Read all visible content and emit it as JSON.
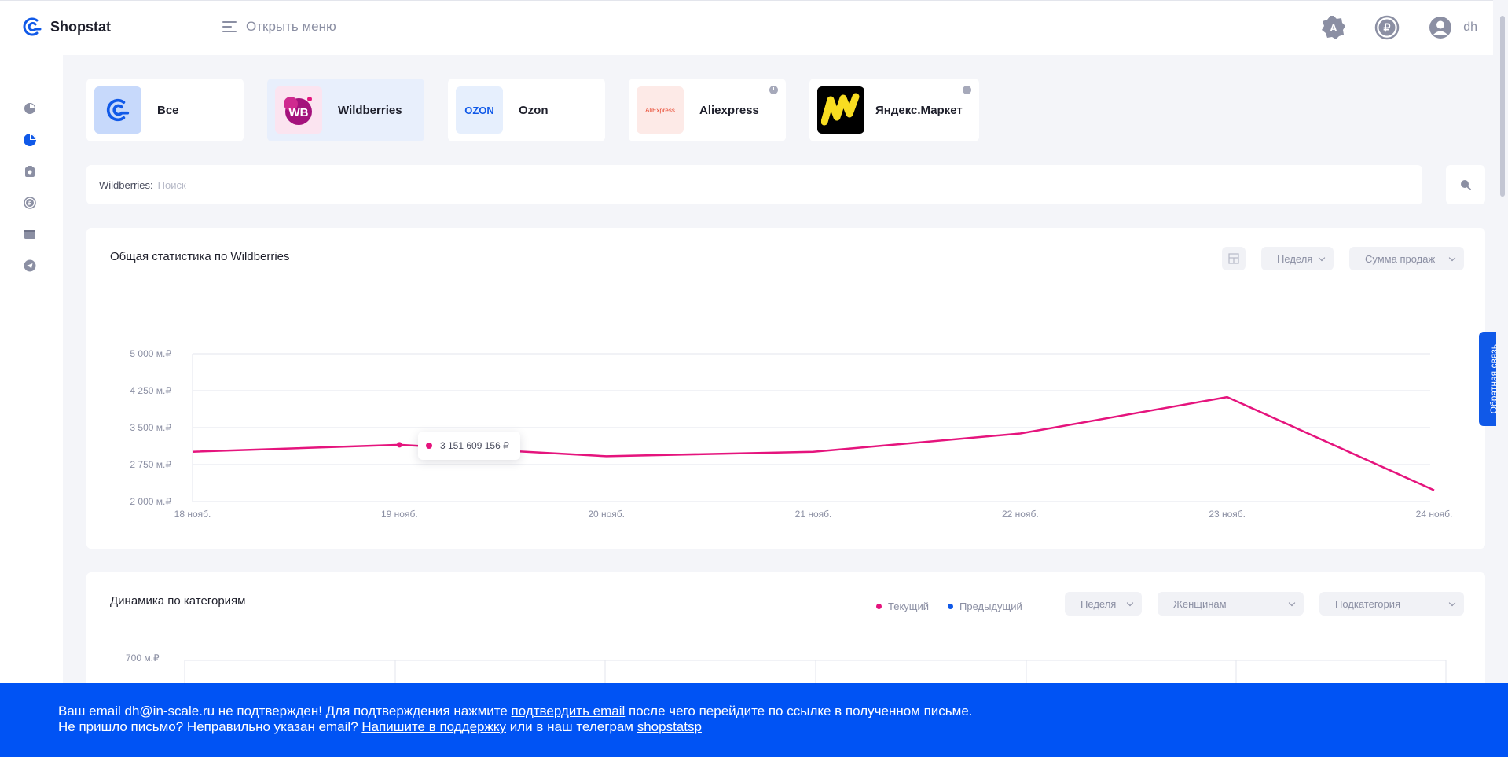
{
  "header": {
    "app_name": "Shopstat",
    "menu_label": "Открыть меню",
    "user_name": "dh"
  },
  "marketplaces": [
    {
      "label": "Все",
      "logo_text": "",
      "active": false,
      "has_clock": false
    },
    {
      "label": "Wildberries",
      "logo_text": "WB",
      "active": true,
      "has_clock": false
    },
    {
      "label": "Ozon",
      "logo_text": "OZON",
      "active": false,
      "has_clock": false
    },
    {
      "label": "Aliexpress",
      "logo_text": "AliExpress",
      "active": false,
      "has_clock": true
    },
    {
      "label": "Яндекс.Маркет",
      "logo_text": "",
      "active": false,
      "has_clock": true
    }
  ],
  "search": {
    "prefix": "Wildberries:",
    "placeholder": "Поиск"
  },
  "stats_panel": {
    "title": "Общая статистика по Wildberries",
    "period_label": "Неделя",
    "metric_label": "Сумма продаж",
    "tooltip_value": "3 151 609 156 ₽"
  },
  "categories_panel": {
    "title": "Динамика по категориям",
    "legend": [
      "Текущий",
      "Предыдущий"
    ],
    "period_label": "Неделя",
    "category_label": "Женщинам",
    "subcategory_label": "Подкатегория",
    "y_tick_top": "700 м.₽"
  },
  "feedback_label": "Обратная связь",
  "banner": {
    "line1_a": "Ваш email dh@in-scale.ru не подтвержден! Для подтверждения нажмите ",
    "line1_link": "подтвердить email",
    "line1_b": " после чего перейдите по ссылке в полученном письме.",
    "line2_a": "Не пришло письмо? Неправильно указан email? ",
    "line2_link": "Напишите в поддержку",
    "line2_b": " или в наш телеграм ",
    "line2_link2": "shopstatsp"
  },
  "colors": {
    "accent": "#0053f4",
    "series": "#e5147d",
    "previous": "#1059e8"
  },
  "chart_data": {
    "type": "line",
    "title": "Общая статистика по Wildberries",
    "x": [
      "18 нояб.",
      "19 нояб.",
      "20 нояб.",
      "21 нояб.",
      "22 нояб.",
      "23 нояб.",
      "24 нояб."
    ],
    "y_ticks": [
      "5 000 м.₽",
      "4 250 м.₽",
      "3 500 м.₽",
      "2 750 м.₽",
      "2 000 м.₽"
    ],
    "ylim": [
      2000,
      5000
    ],
    "series": [
      {
        "values": [
          3010,
          3150,
          2920,
          3010,
          3380,
          4120,
          2230
        ]
      }
    ],
    "grid": true
  }
}
